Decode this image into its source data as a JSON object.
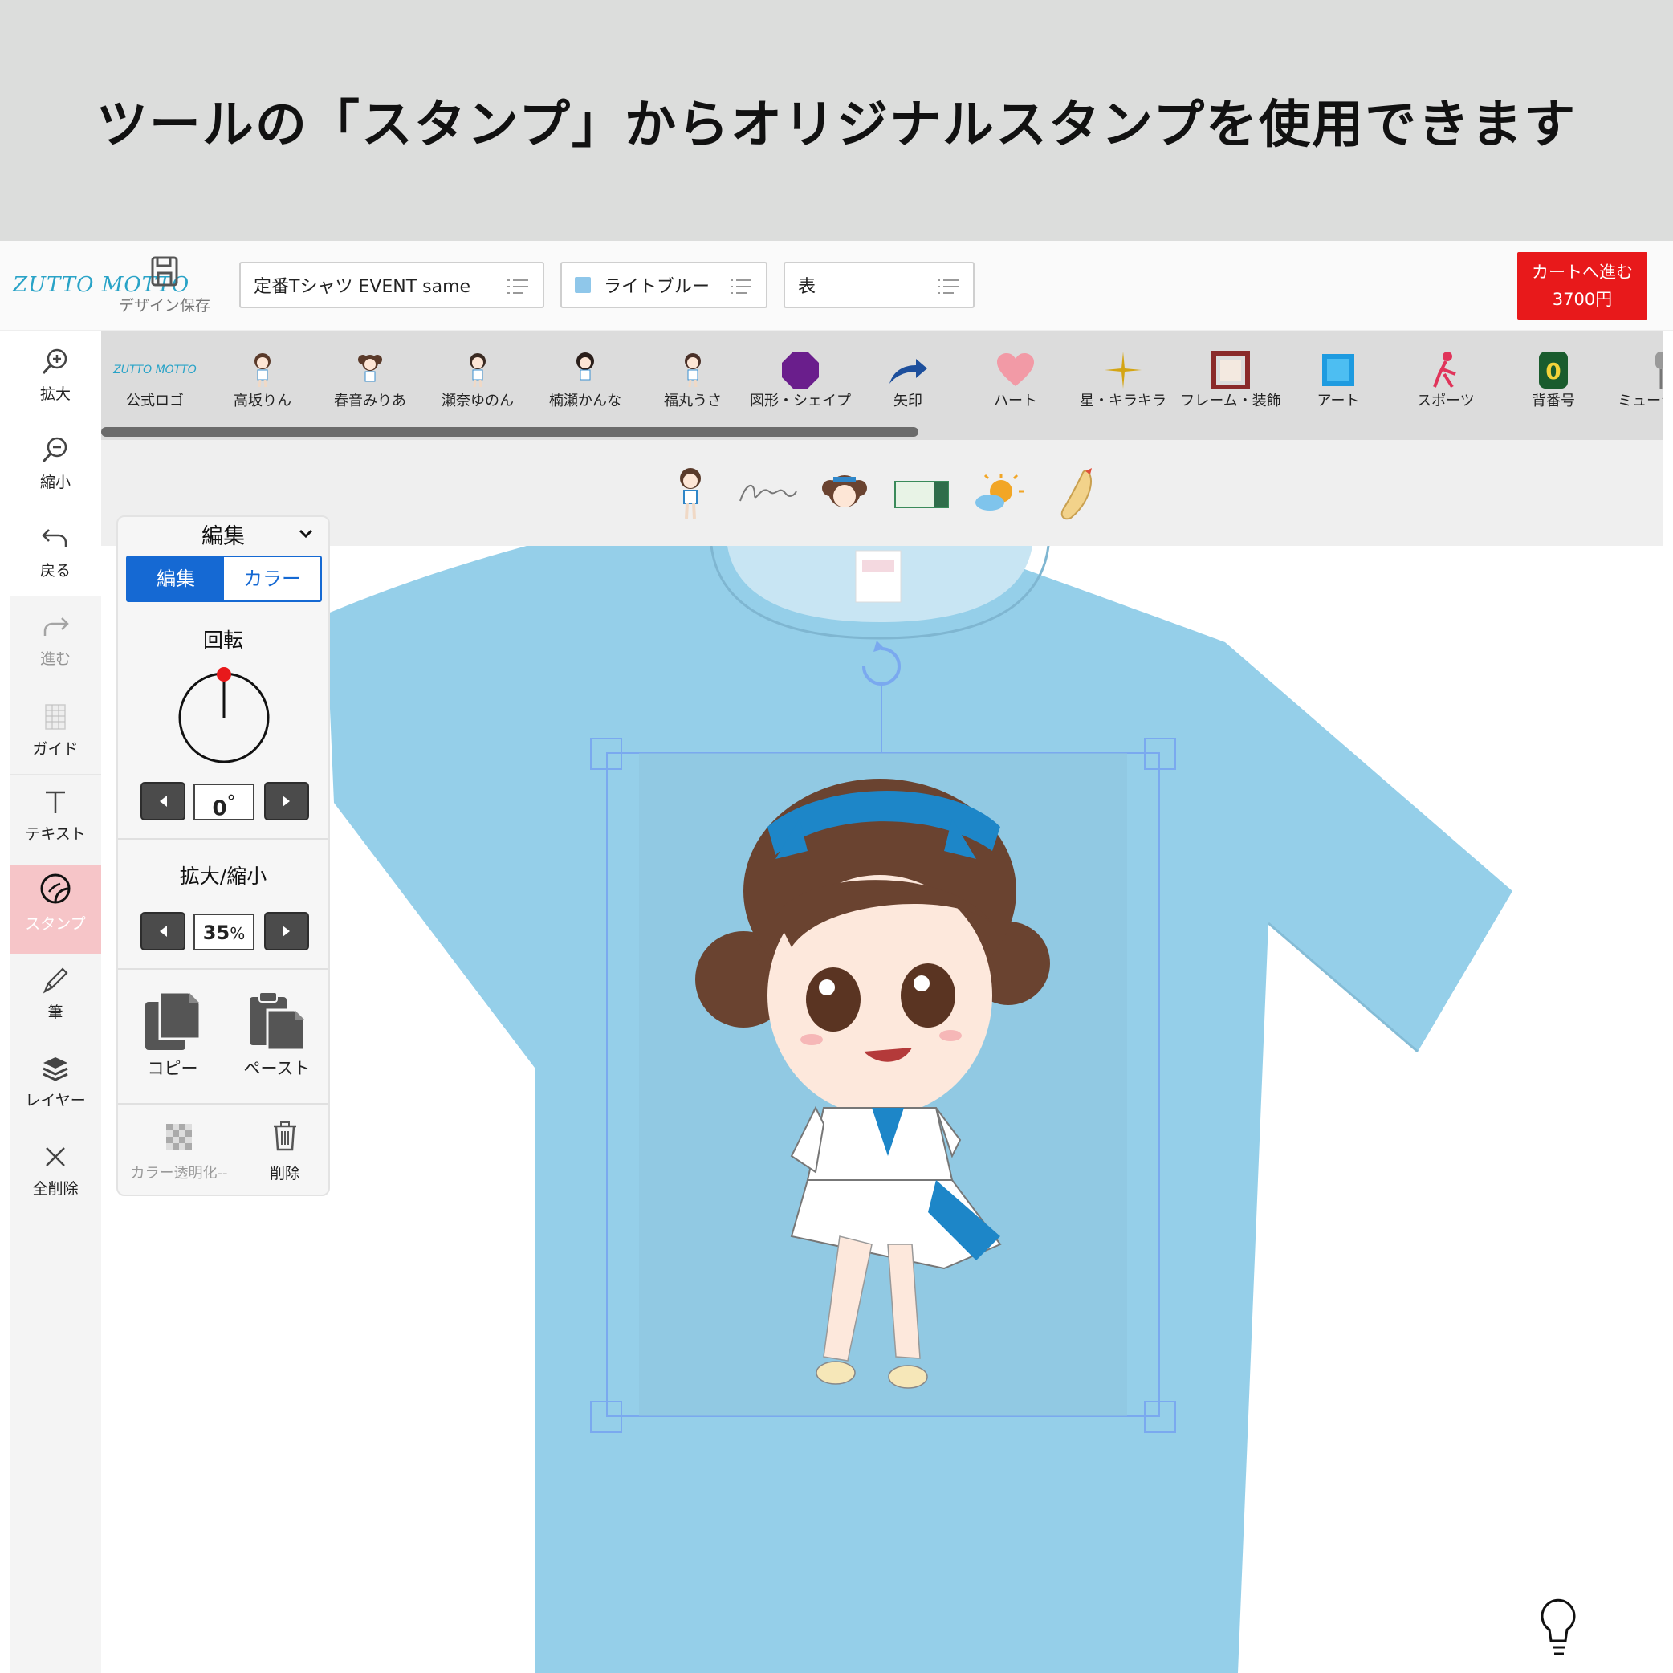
{
  "banner": {
    "title": "ツールの「スタンプ」からオリジナルスタンプを使用できます"
  },
  "header": {
    "logo": "ZUTTO MOTTO",
    "save_label": "デザイン保存",
    "product": "定番Tシャツ EVENT same",
    "color": "ライトブルー",
    "side": "表",
    "cart_label": "カートへ進む",
    "cart_price": "3700円",
    "color_swatch": "#8fc7ea"
  },
  "tools": [
    {
      "label": "拡大",
      "icon": "zoom-in-icon"
    },
    {
      "label": "縮小",
      "icon": "zoom-out-icon"
    },
    {
      "label": "戻る",
      "icon": "undo-icon"
    },
    {
      "label": "進む",
      "icon": "redo-icon"
    },
    {
      "label": "ガイド",
      "icon": "guide-icon"
    },
    {
      "label": "テキスト",
      "icon": "text-icon"
    },
    {
      "label": "スタンプ",
      "icon": "stamp-icon"
    },
    {
      "label": "筆",
      "icon": "brush-icon"
    },
    {
      "label": "レイヤー",
      "icon": "layers-icon"
    },
    {
      "label": "全削除",
      "icon": "clear-all-icon"
    }
  ],
  "categories": [
    "公式ロゴ",
    "高坂りん",
    "春音みりあ",
    "瀬奈ゆのん",
    "楠瀬かんな",
    "福丸うさ",
    "図形・シェイプ",
    "矢印",
    "ハート",
    "星・キラキラ",
    "フレーム・装飾",
    "アート",
    "スポーツ",
    "背番号",
    "ミュージック"
  ],
  "stamp_items": [
    "character-stamp",
    "signature-stamp",
    "face-stamp",
    "ticket-stamp",
    "sun-cloud-stamp",
    "fried-shrimp-stamp"
  ],
  "panel": {
    "title": "編集",
    "tab_edit": "編集",
    "tab_color": "カラー",
    "rotation_label": "回転",
    "rotation_value": "0",
    "rotation_unit": "°",
    "scale_label": "拡大/縮小",
    "scale_value": "35",
    "scale_unit": "%",
    "copy_label": "コピー",
    "paste_label": "ペースト",
    "transparent_label": "カラー透明化--",
    "delete_label": "削除"
  },
  "colors": {
    "accent": "#1569d3",
    "cart": "#e8191b",
    "shirt": "#95cfe9",
    "active_tool": "#f6c5c8"
  }
}
